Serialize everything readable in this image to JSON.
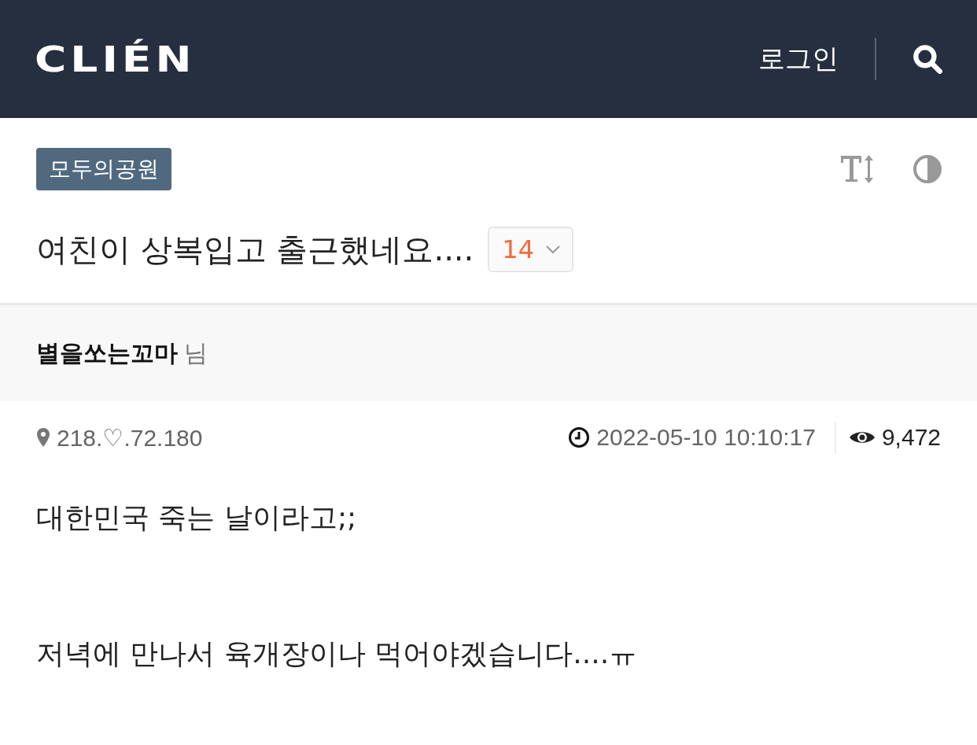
{
  "header": {
    "logo": "CLIÉN",
    "login": "로그인"
  },
  "board": {
    "tag": "모두의공원"
  },
  "post": {
    "title": "여친이 상복입고 출근했네요....",
    "comment_count": "14"
  },
  "author": {
    "name": "별을쏘는꼬마",
    "suffix": "님"
  },
  "meta": {
    "ip": "218.♡.72.180",
    "datetime": "2022-05-10 10:10:17",
    "views": "9,472"
  },
  "body": [
    "대한민국 죽는 날이라고;;",
    "저녁에 만나서 육개장이나 먹어야겠습니다....ㅠ"
  ]
}
